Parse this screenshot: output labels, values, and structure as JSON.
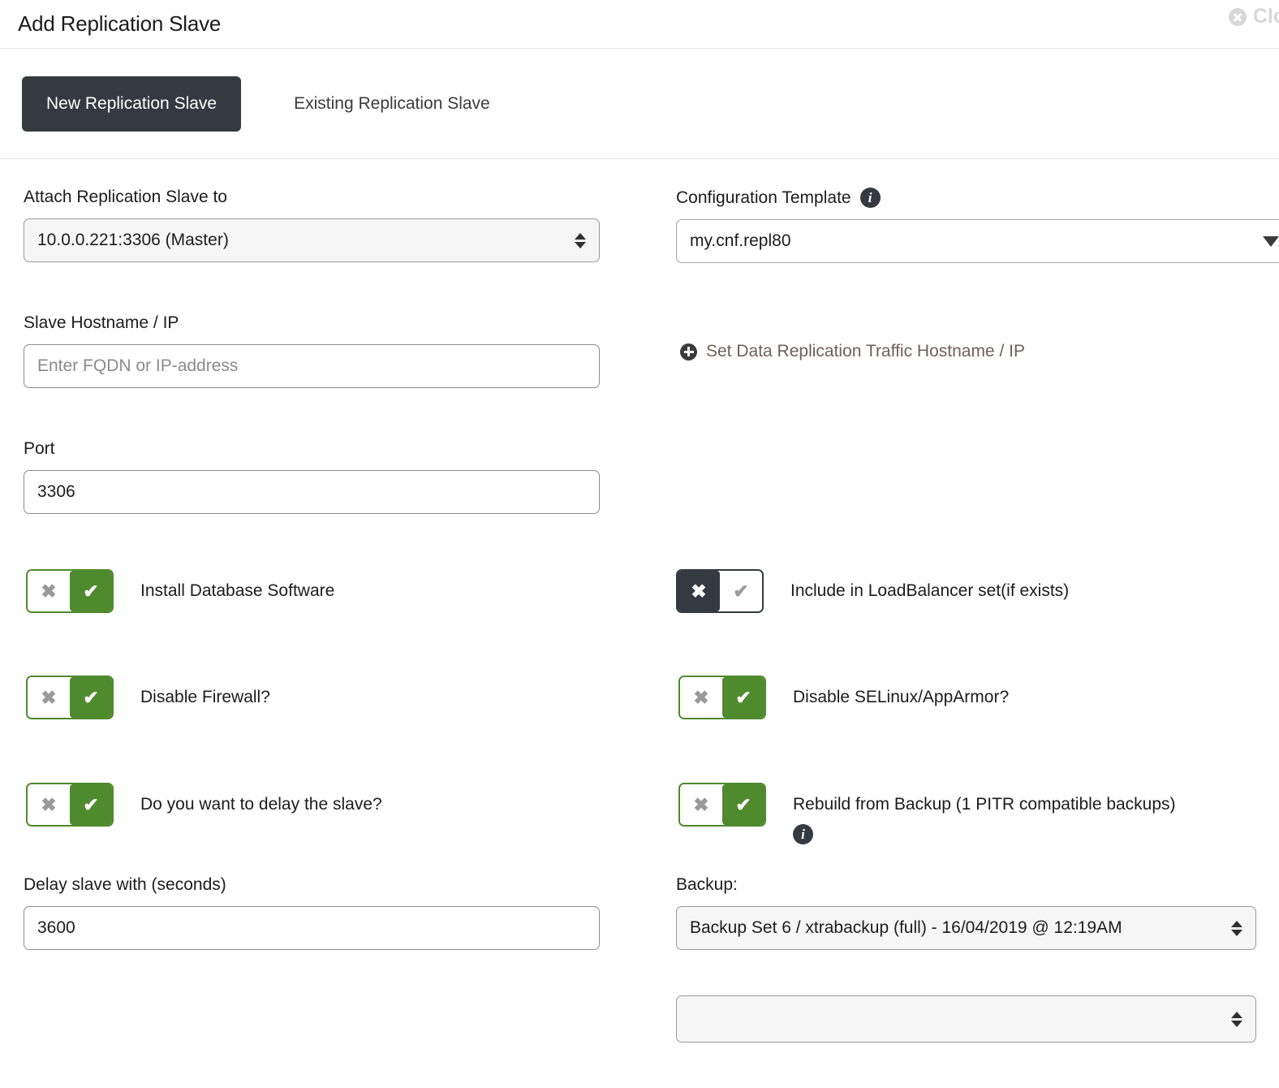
{
  "header": {
    "title": "Add Replication Slave",
    "close_label": "Clos",
    "close_icon": "close-circle-icon"
  },
  "tabs": [
    {
      "label": "New Replication Slave",
      "active": true
    },
    {
      "label": "Existing Replication Slave",
      "active": false
    }
  ],
  "left": {
    "attach_label": "Attach Replication Slave to",
    "attach_value": "10.0.0.221:3306 (Master)",
    "hostname_label": "Slave Hostname / IP",
    "hostname_value": "",
    "hostname_placeholder": "Enter FQDN or IP-address",
    "port_label": "Port",
    "port_value": "3306",
    "delay_label": "Delay slave with (seconds)",
    "delay_value": "3600"
  },
  "right": {
    "template_label": "Configuration Template",
    "template_value": "my.cnf.repl80",
    "template_info_icon": "info-icon",
    "traffic_link": "Set Data Replication Traffic Hostname / IP",
    "traffic_link_icon": "plus-circle-icon",
    "backup_label": "Backup:",
    "backup_value": "Backup Set 6 / xtrabackup (full) - 16/04/2019 @ 12:19AM",
    "extra_select_value": ""
  },
  "toggles": {
    "install_db": {
      "label": "Install Database Software",
      "state": "on"
    },
    "loadbalancer": {
      "label": "Include in LoadBalancer set(if exists)",
      "state": "off"
    },
    "firewall": {
      "label": "Disable Firewall?",
      "state": "on"
    },
    "selinux": {
      "label": "Disable SELinux/AppArmor?",
      "state": "on"
    },
    "delay_slave": {
      "label": "Do you want to delay the slave?",
      "state": "on"
    },
    "rebuild_backup": {
      "label": "Rebuild from Backup (1 PITR compatible backups)",
      "state": "on",
      "info_icon": "info-icon"
    }
  },
  "icons": {
    "check": "✔",
    "cross": "✖"
  },
  "colors": {
    "accent_green": "#4f8a2e",
    "dark": "#343a40",
    "link_gray": "#6d6159"
  }
}
